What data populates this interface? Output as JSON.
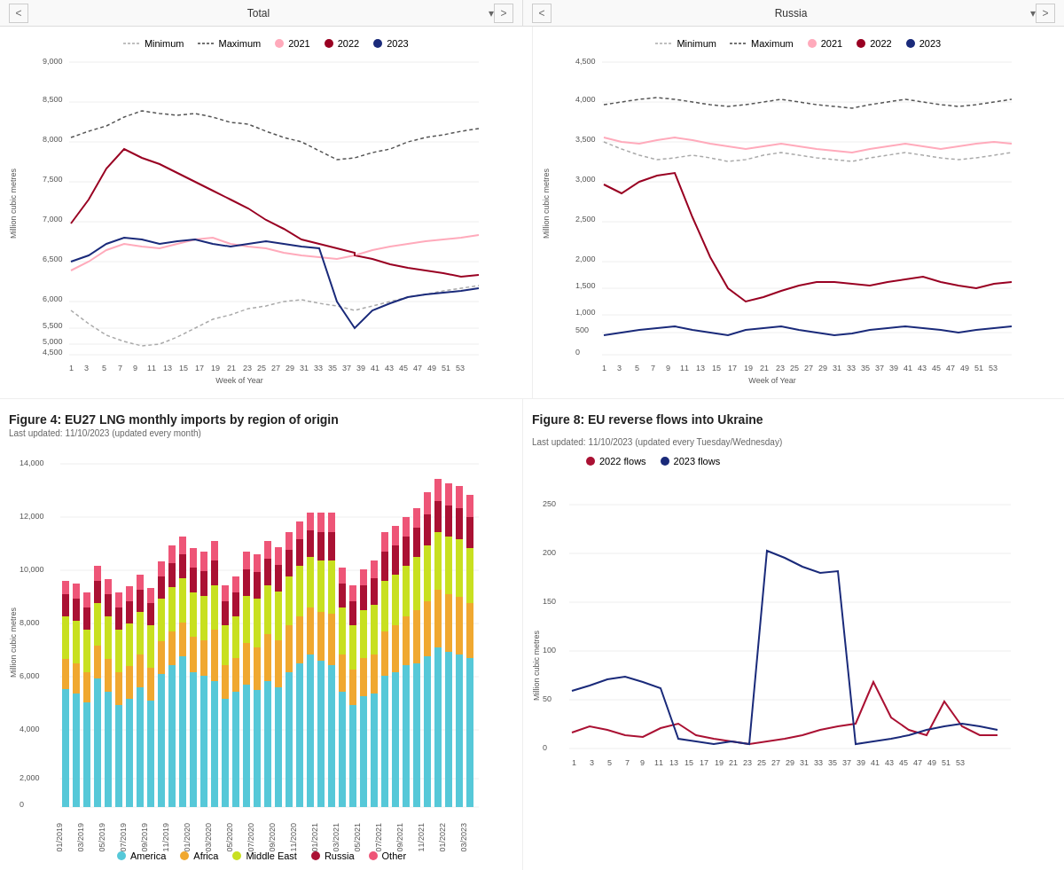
{
  "charts": {
    "total": {
      "title": "Total",
      "nav_prev": "<",
      "nav_next": ">"
    },
    "russia": {
      "title": "Russia",
      "nav_prev": "<",
      "nav_next": ">"
    },
    "lng": {
      "title": "Figure 4: EU27 LNG monthly imports by region of origin",
      "subtitle": "Last updated: 11/10/2023 (updated every month)",
      "y_label": "Million cubic metres",
      "legend": [
        "America",
        "Africa",
        "Middle East",
        "Russia",
        "Other"
      ]
    },
    "ukraine": {
      "title": "Figure 8: EU reverse flows into Ukraine",
      "subtitle": "Last updated: 11/10/2023 (updated every Tuesday/Wednesday)",
      "y_label": "Million cubic metres",
      "legend": [
        "2022 flows",
        "2023 flows"
      ]
    }
  },
  "legend": {
    "minimum": "Minimum",
    "maximum": "Maximum",
    "y2021": "2021",
    "y2022": "2022",
    "y2023": "2023"
  },
  "colors": {
    "minimum": "#cccccc",
    "maximum": "#555555",
    "y2021": "#ffaabb",
    "y2022": "#990022",
    "y2023": "#1a2a7a",
    "america": "#56c8d8",
    "africa": "#f0a830",
    "middle_east": "#c8e020",
    "russia": "#aa1133",
    "other": "#ee5577",
    "flows2022": "#aa1133",
    "flows2023": "#1a2a7a"
  }
}
